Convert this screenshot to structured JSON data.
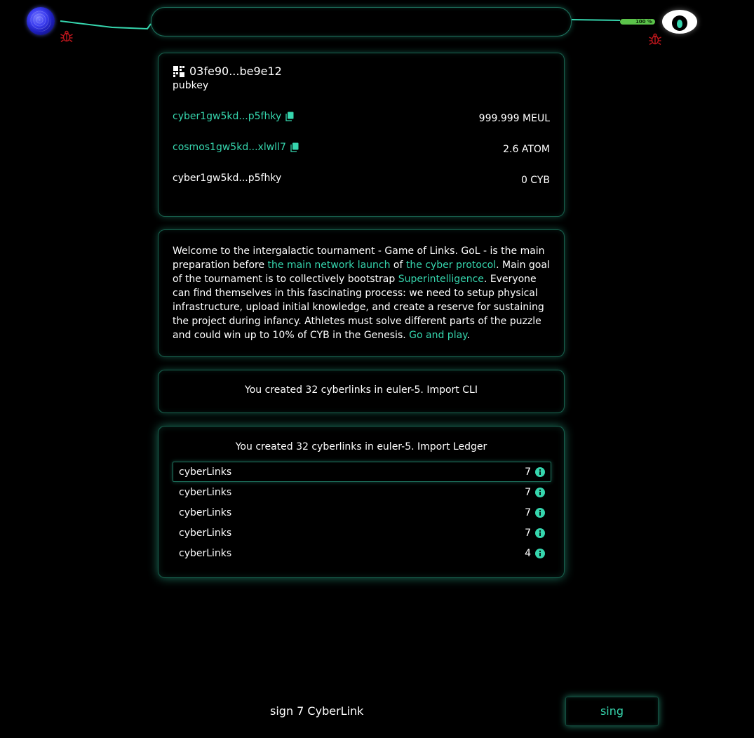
{
  "header": {
    "battery_label": "100 %",
    "search_placeholder": ""
  },
  "profile": {
    "pubkey_value": "03fe90...be9e12",
    "pubkey_label": "pubkey",
    "addresses": [
      {
        "address": "cyber1gw5kd...p5fhky",
        "balance": "999.999 MEUL",
        "link": true
      },
      {
        "address": "cosmos1gw5kd...xlwll7",
        "balance": "2.6 ATOM",
        "link": true
      },
      {
        "address": "cyber1gw5kd...p5fhky",
        "balance": "0 CYB",
        "link": false
      }
    ]
  },
  "welcome": {
    "t1": "Welcome to the intergalactic tournament - Game of Links. GoL - is the main preparation before ",
    "l1": "the main network launch",
    "t2": " of ",
    "l2": "the cyber protocol",
    "t3": ". Main goal of the tournament is to collectively bootstrap ",
    "l3": "Superintelligence",
    "t4": ". Everyone can find themselves in this fascinating process: we need to setup physical infrastructure, upload initial knowledge, and create a reserve for sustaining the project during infancy. Athletes must solve different parts of the puzzle and could win up to 10% of CYB in the Genesis. ",
    "l4": "Go and play",
    "t5": "."
  },
  "cli_card": {
    "text": "You created 32 cyberlinks in euler-5. Import CLI"
  },
  "ledger_card": {
    "title": "You created 32 cyberlinks in euler-5. Import Ledger",
    "rows": [
      {
        "label": "cyberLinks",
        "count": "7"
      },
      {
        "label": "cyberLinks",
        "count": "7"
      },
      {
        "label": "cyberLinks",
        "count": "7"
      },
      {
        "label": "cyberLinks",
        "count": "7"
      },
      {
        "label": "cyberLinks",
        "count": "4"
      }
    ]
  },
  "footer": {
    "sign_text": "sign 7 CyberLink",
    "button_label": "sing"
  },
  "colors": {
    "accent": "#36d6ae",
    "background": "#000000",
    "battery": "#5bc34a",
    "bug": "#c0161c"
  },
  "icons": {
    "logo": "cyber-logo-icon",
    "bug": "bug-icon",
    "eye": "eye-icon",
    "pubkey": "key-blocks-icon",
    "copy": "copy-icon",
    "info": "info-icon"
  }
}
